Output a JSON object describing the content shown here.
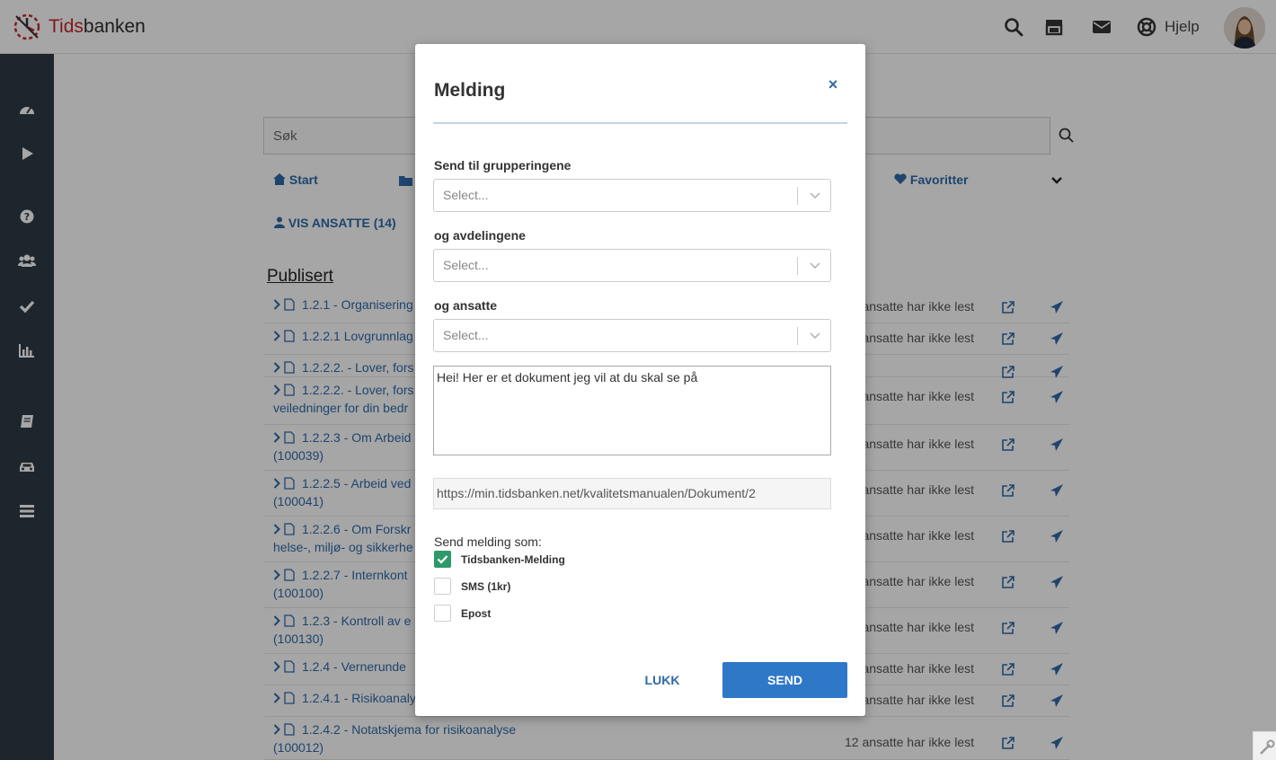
{
  "header": {
    "logo_text_red": "Tids",
    "logo_text_dark": "banken",
    "help_label": "Hjelp",
    "icons": [
      "search-icon",
      "store-icon",
      "envelope-icon",
      "life-ring-icon"
    ]
  },
  "sidebar": {
    "icons": [
      "dashboard-icon",
      "play-icon",
      "question-icon",
      "users-icon",
      "check-icon",
      "bar-chart-icon",
      "book-icon",
      "car-icon",
      "list-icon"
    ]
  },
  "main": {
    "search_placeholder": "Søk",
    "nav": {
      "start": "Start",
      "favoritter": "Favoritter"
    },
    "vis_ansatte": "VIS ANSATTE (14)",
    "section_title": "Publisert",
    "rows": [
      {
        "title": "1.2.1 - Organisering",
        "status": "ansatte har ikke lest"
      },
      {
        "title": "1.2.2.1 Lovgrunnlag",
        "status": "ansatte har ikke lest"
      },
      {
        "title": "1.2.2.2. - Lover, fors",
        "status": ""
      },
      {
        "title": "1.2.2.2. - Lover, fors",
        "title2": "veiledninger for din bedr",
        "status": "ansatte har ikke lest"
      },
      {
        "title": "1.2.2.3 - Om Arbeid",
        "title2": "(100039)",
        "status": "ansatte har ikke lest"
      },
      {
        "title": "1.2.2.5 - Arbeid ved",
        "title2": "(100041)",
        "status": "ansatte har ikke lest"
      },
      {
        "title": "1.2.2.6 - Om Forskr",
        "title2": "helse-, miljø- og sikkerhe",
        "status": "ansatte har ikke lest"
      },
      {
        "title": "1.2.2.7 - Internkont",
        "title2": "(100100)",
        "status": "ansatte har ikke lest"
      },
      {
        "title": "1.2.3 - Kontroll av e",
        "title2": "(100130)",
        "status": "ansatte har ikke lest"
      },
      {
        "title": "1.2.4 - Vernerunde",
        "status": "ansatte har ikke lest"
      },
      {
        "title": "1.2.4.1 - Risikoanaly",
        "status": "ansatte har ikke lest"
      },
      {
        "title": "1.2.4.2 - Notatskjema for risikoanalyse",
        "title2": "(100012)",
        "status": "12 ansatte har ikke lest"
      }
    ]
  },
  "modal": {
    "title": "Melding",
    "close_label": "×",
    "groups_label": "Send til grupperingene",
    "groups_placeholder": "Select...",
    "departments_label": "og avdelingene",
    "departments_placeholder": "Select...",
    "employees_label": "og ansatte",
    "employees_placeholder": "Select...",
    "message": "Hei! Her er et dokument jeg vil at du skal se på",
    "link": "https://min.tidsbanken.net/kvalitetsmanualen/Dokument/2",
    "send_as_label": "Send melding som:",
    "options": [
      {
        "label": "Tidsbanken-Melding",
        "checked": true
      },
      {
        "label": "SMS (1kr)",
        "checked": false
      },
      {
        "label": "Epost",
        "checked": false
      }
    ],
    "close_button": "LUKK",
    "send_button": "SEND"
  },
  "colors": {
    "brand_red": "#c8262c",
    "link_blue": "#2f6aa8",
    "primary_button": "#2f78c8",
    "checkbox_green": "#2e9a6a",
    "sidebar_bg": "#2f3b46"
  }
}
